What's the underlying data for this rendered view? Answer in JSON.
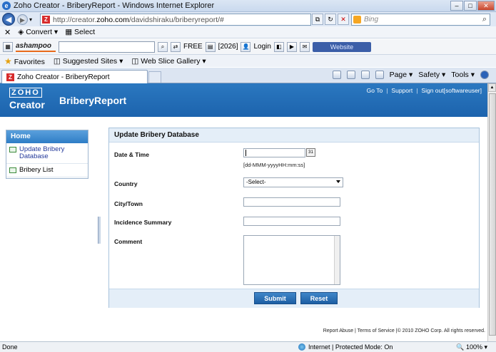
{
  "window": {
    "title": "Zoho Creator - BriberyReport - Windows Internet Explorer"
  },
  "addressbar": {
    "url_prefix": "http://creator.",
    "url_domain": "zoho.com",
    "url_rest": "/davidshiraku/briberyreport/#",
    "search_placeholder": "Bing"
  },
  "toolbar1": {
    "convert": "Convert",
    "select": "Select"
  },
  "toolbar2": {
    "brand": "ashampoo",
    "free": "FREE",
    "count": "[2026]",
    "login": "Login",
    "website": "Website"
  },
  "favorites": {
    "favorites": "Favorites",
    "suggested": "Suggested Sites",
    "webslice": "Web Slice Gallery"
  },
  "tab": {
    "label": "Zoho Creator - BriberyReport"
  },
  "commandbar": {
    "page": "Page",
    "safety": "Safety",
    "tools": "Tools"
  },
  "app": {
    "logo_top": "ZOHO",
    "logo_bottom": "Creator",
    "title": "BriberyReport",
    "links": {
      "goto": "Go To",
      "support": "Support",
      "signout": "Sign out[softwareuser]"
    }
  },
  "nav": {
    "home": "Home",
    "items": [
      "Update Bribery Database",
      "Bribery List"
    ]
  },
  "form": {
    "title": "Update Bribery Database",
    "fields": {
      "datetime": "Date & Time",
      "date_hint": "[dd-MMM-yyyyHH:mm:ss]",
      "country": "Country",
      "country_value": "-Select-",
      "city": "City/Town",
      "summary": "Incidence Summary",
      "comment": "Comment"
    },
    "submit": "Submit",
    "reset": "Reset"
  },
  "footer": {
    "text": "Report Abuse | Terms of Service |© 2010 ZOHO Corp. All rights reserved."
  },
  "status": {
    "left": "Done",
    "zone": "Internet | Protected Mode: On",
    "zoom": "100%"
  }
}
